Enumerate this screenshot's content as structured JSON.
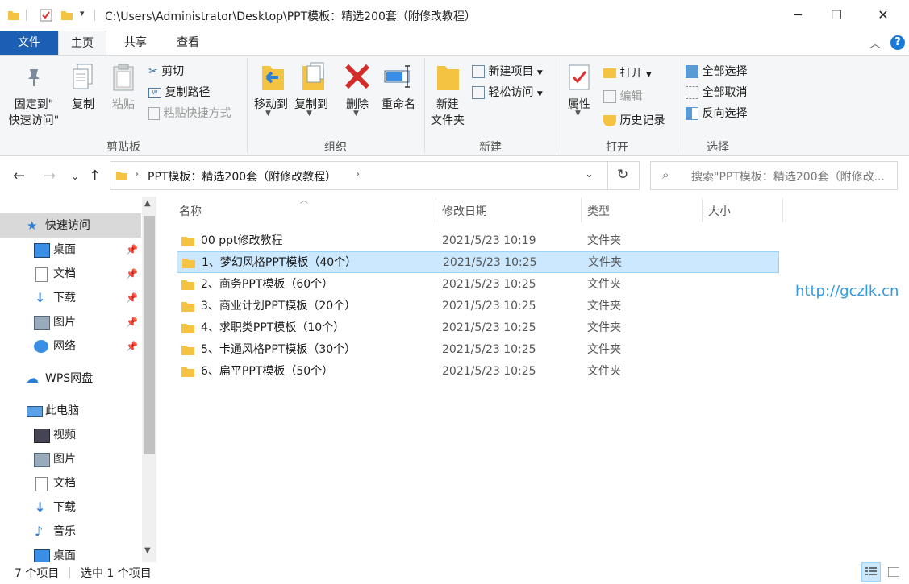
{
  "titlebar": {
    "path": "C:\\Users\\Administrator\\Desktop\\PPT模板：精选200套（附修改教程）",
    "minimize": "─",
    "maximize": "☐",
    "close": "✕"
  },
  "tabs": {
    "file": "文件",
    "home": "主页",
    "share": "共享",
    "view": "查看"
  },
  "ribbon": {
    "clipboard": {
      "label": "剪贴板",
      "pin_quick": "固定到\"",
      "pin_quick2": "快速访问\"",
      "copy": "复制",
      "paste": "粘贴",
      "cut": "剪切",
      "copy_path": "复制路径",
      "paste_shortcut": "粘贴快捷方式"
    },
    "organize": {
      "label": "组织",
      "move_to": "移动到",
      "copy_to": "复制到",
      "delete": "删除",
      "rename": "重命名"
    },
    "new": {
      "label": "新建",
      "new_folder": "新建",
      "new_folder2": "文件夹",
      "new_item": "新建项目",
      "easy_access": "轻松访问"
    },
    "open": {
      "label": "打开",
      "properties": "属性",
      "open": "打开",
      "edit": "编辑",
      "history": "历史记录"
    },
    "select": {
      "label": "选择",
      "select_all": "全部选择",
      "select_none": "全部取消",
      "invert": "反向选择"
    }
  },
  "address": {
    "crumb": "PPT模板：精选200套（附修改教程）",
    "search_placeholder": "搜索\"PPT模板：精选200套（附修改..."
  },
  "nav": {
    "items": [
      {
        "label": "快速访问",
        "icon": "star-icon",
        "pinned": false
      },
      {
        "label": "桌面",
        "icon": "desktop-icon",
        "pinned": true
      },
      {
        "label": "文档",
        "icon": "document-icon",
        "pinned": true
      },
      {
        "label": "下载",
        "icon": "download-icon",
        "pinned": true
      },
      {
        "label": "图片",
        "icon": "picture-icon",
        "pinned": true
      },
      {
        "label": "网络",
        "icon": "network-icon",
        "pinned": true
      },
      {
        "label": "WPS网盘",
        "icon": "cloud-icon",
        "pinned": false
      },
      {
        "label": "此电脑",
        "icon": "computer-icon",
        "pinned": false
      },
      {
        "label": "视频",
        "icon": "video-icon",
        "pinned": false
      },
      {
        "label": "图片",
        "icon": "picture-icon",
        "pinned": false
      },
      {
        "label": "文档",
        "icon": "document-icon",
        "pinned": false
      },
      {
        "label": "下载",
        "icon": "download-icon",
        "pinned": false
      },
      {
        "label": "音乐",
        "icon": "music-icon",
        "pinned": false
      },
      {
        "label": "桌面",
        "icon": "desktop-icon",
        "pinned": false
      }
    ]
  },
  "columns": {
    "name": "名称",
    "date": "修改日期",
    "type": "类型",
    "size": "大小"
  },
  "files": [
    {
      "name": "00 ppt修改教程",
      "date": "2021/5/23 10:19",
      "type": "文件夹",
      "selected": false
    },
    {
      "name": "1、梦幻风格PPT模板（40个）",
      "date": "2021/5/23 10:25",
      "type": "文件夹",
      "selected": true
    },
    {
      "name": "2、商务PPT模板（60个）",
      "date": "2021/5/23 10:25",
      "type": "文件夹",
      "selected": false
    },
    {
      "name": "3、商业计划PPT模板（20个）",
      "date": "2021/5/23 10:25",
      "type": "文件夹",
      "selected": false
    },
    {
      "name": "4、求职类PPT模板（10个）",
      "date": "2021/5/23 10:25",
      "type": "文件夹",
      "selected": false
    },
    {
      "name": "5、卡通风格PPT模板（30个）",
      "date": "2021/5/23 10:25",
      "type": "文件夹",
      "selected": false
    },
    {
      "name": "6、扁平PPT模板（50个）",
      "date": "2021/5/23 10:25",
      "type": "文件夹",
      "selected": false
    }
  ],
  "watermark": "http://gczlk.cn",
  "status": {
    "count": "7 个项目",
    "selected": "选中 1 个项目"
  },
  "colors": {
    "accent": "#1a5fb4",
    "selection": "#cce8ff",
    "folder": "#f5c342",
    "watermark": "#2f9be6"
  }
}
